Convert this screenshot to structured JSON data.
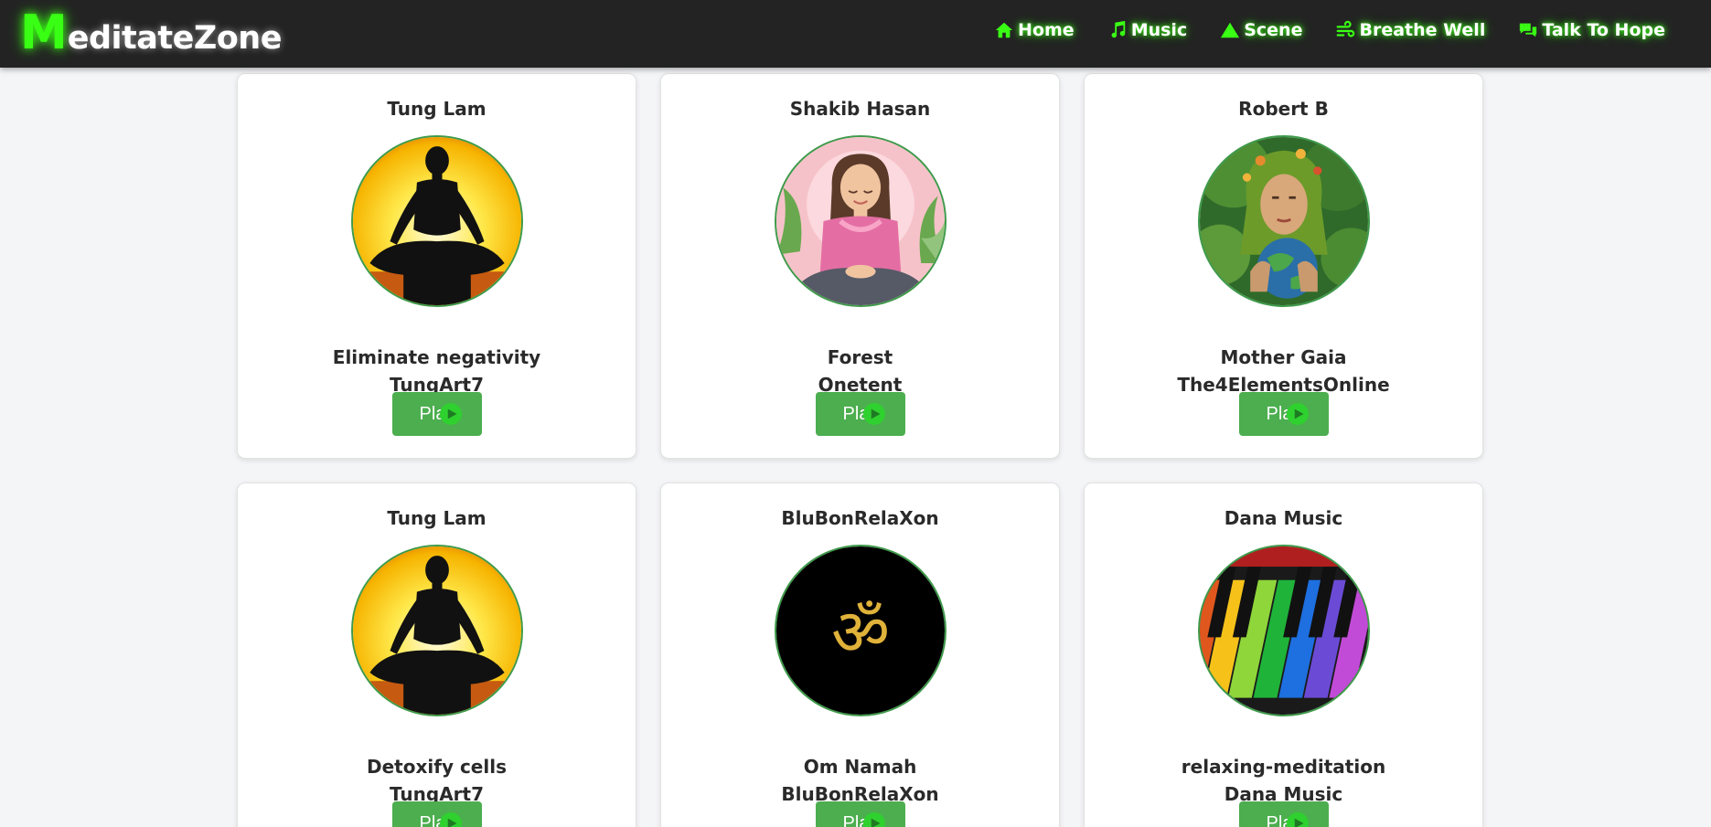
{
  "navbar": {
    "logo_initial": "M",
    "logo_rest": "editateZone",
    "links": [
      {
        "label": "Home",
        "icon": "home-icon"
      },
      {
        "label": "Music",
        "icon": "music-note-icon"
      },
      {
        "label": "Scene",
        "icon": "mountain-icon"
      },
      {
        "label": "Breathe Well",
        "icon": "wind-icon"
      },
      {
        "label": "Talk To Hope",
        "icon": "chat-bubbles-icon"
      }
    ]
  },
  "cards": [
    {
      "artist": "Tung Lam",
      "title": "Eliminate negativity",
      "channel": "TungArt7",
      "image": "meditation-silhouette-sunrise",
      "play_label": "Play"
    },
    {
      "artist": "Shakib Hasan",
      "title": "Forest",
      "channel": "Onetent",
      "image": "girl-meditating-pink",
      "play_label": "Play"
    },
    {
      "artist": "Robert B",
      "title": "Mother Gaia",
      "channel": "The4ElementsOnline",
      "image": "mother-gaia-earth",
      "play_label": "Play"
    },
    {
      "artist": "Tung Lam",
      "title": "Detoxify cells",
      "channel": "TungArt7",
      "image": "meditation-silhouette-sunrise",
      "play_label": "Play"
    },
    {
      "artist": "BluBonRelaXon",
      "title": "Om Namah",
      "channel": "BluBonRelaXon",
      "image": "om-symbol-gold",
      "play_label": "Play"
    },
    {
      "artist": "Dana Music",
      "title": "relaxing-meditation",
      "channel": "Dana Music",
      "image": "rainbow-piano-keys",
      "play_label": "Play"
    }
  ],
  "colors": {
    "accent": "#39ff14",
    "navbar_bg": "#232323",
    "button": "#4cae4f",
    "page_bg": "#f4f5f7"
  }
}
